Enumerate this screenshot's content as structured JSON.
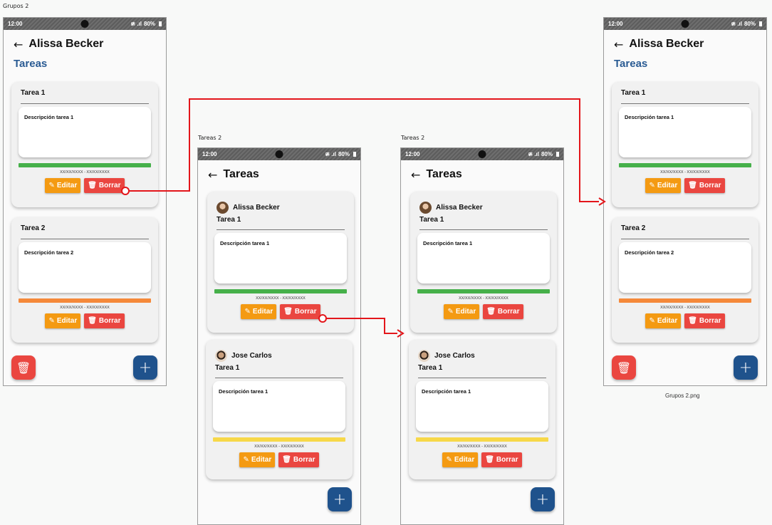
{
  "frames": {
    "grupos_label": "Grupos 2",
    "tareas_label_1": "Tareas 2",
    "tareas_label_2": "Tareas 2",
    "caption_final": "Grupos 2.png"
  },
  "status": {
    "time": "12:00",
    "signal": "≇ .ıl",
    "battery": "80%"
  },
  "grupos_screen": {
    "back_icon": "←",
    "title": "Alissa Becker",
    "section": "Tareas",
    "tasks": [
      {
        "name": "Tarea 1",
        "description": "Descripción tarea 1",
        "dates": "XX/XX/XXXX - XX/XX/XXXX",
        "bar_color": "#46b04a"
      },
      {
        "name": "Tarea 2",
        "description": "Descripción tarea 2",
        "dates": "XX/XX/XXXX - XX/XX/XXXX",
        "bar_color": "#f5893a"
      }
    ]
  },
  "tareas_screen": {
    "back_icon": "←",
    "title": "Tareas",
    "tasks": [
      {
        "user": "Alissa Becker",
        "name": "Tarea 1",
        "description": "Descripción tarea 1",
        "dates": "XX/XX/XXXX - XX/XX/XXXX",
        "bar_color": "#46b04a"
      },
      {
        "user": "Jose Carlos",
        "name": "Tarea 1",
        "description": "Descripción tarea 1",
        "dates": "XX/XX/XXXX - XX/XX/XXXX",
        "bar_color": "#f7d849"
      }
    ]
  },
  "buttons": {
    "edit": "Editar",
    "delete": "Borrar",
    "edit_icon": "✎",
    "delete_icon": "🗑",
    "add_icon": "+",
    "trash_icon": "🗑"
  },
  "colors": {
    "accent_blue": "#1f528c",
    "danger": "#ea4640",
    "warning": "#f49a12",
    "arrow": "#e3161b"
  }
}
